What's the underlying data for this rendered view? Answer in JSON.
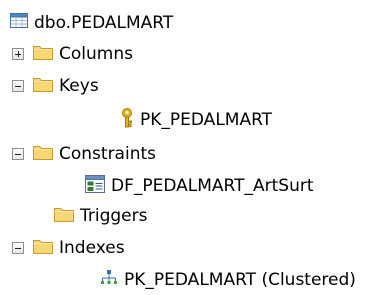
{
  "tree": {
    "root": {
      "label": "dbo.PEDALMART",
      "icon": "table-icon"
    },
    "nodes": [
      {
        "id": "columns",
        "label": "Columns",
        "icon": "folder-icon",
        "expander": "collapsed"
      },
      {
        "id": "keys",
        "label": "Keys",
        "icon": "folder-icon",
        "expander": "expanded",
        "children": [
          {
            "label": "PK_PEDALMART",
            "icon": "primary-key-icon"
          }
        ]
      },
      {
        "id": "constraints",
        "label": "Constraints",
        "icon": "folder-icon",
        "expander": "expanded",
        "children": [
          {
            "label": "DF_PEDALMART_ArtSurt",
            "icon": "constraint-icon"
          }
        ]
      },
      {
        "id": "triggers",
        "label": "Triggers",
        "icon": "folder-icon",
        "expander": "none"
      },
      {
        "id": "indexes",
        "label": "Indexes",
        "icon": "folder-icon",
        "expander": "expanded",
        "children": [
          {
            "label": "PK_PEDALMART (Clustered)",
            "icon": "index-icon"
          }
        ]
      }
    ]
  },
  "colors": {
    "folder_fill": "#f8d775",
    "folder_border": "#c79a2b",
    "table_header": "#4a86c7",
    "key_gold": "#e6b422",
    "index_blue": "#2f6fb5"
  }
}
